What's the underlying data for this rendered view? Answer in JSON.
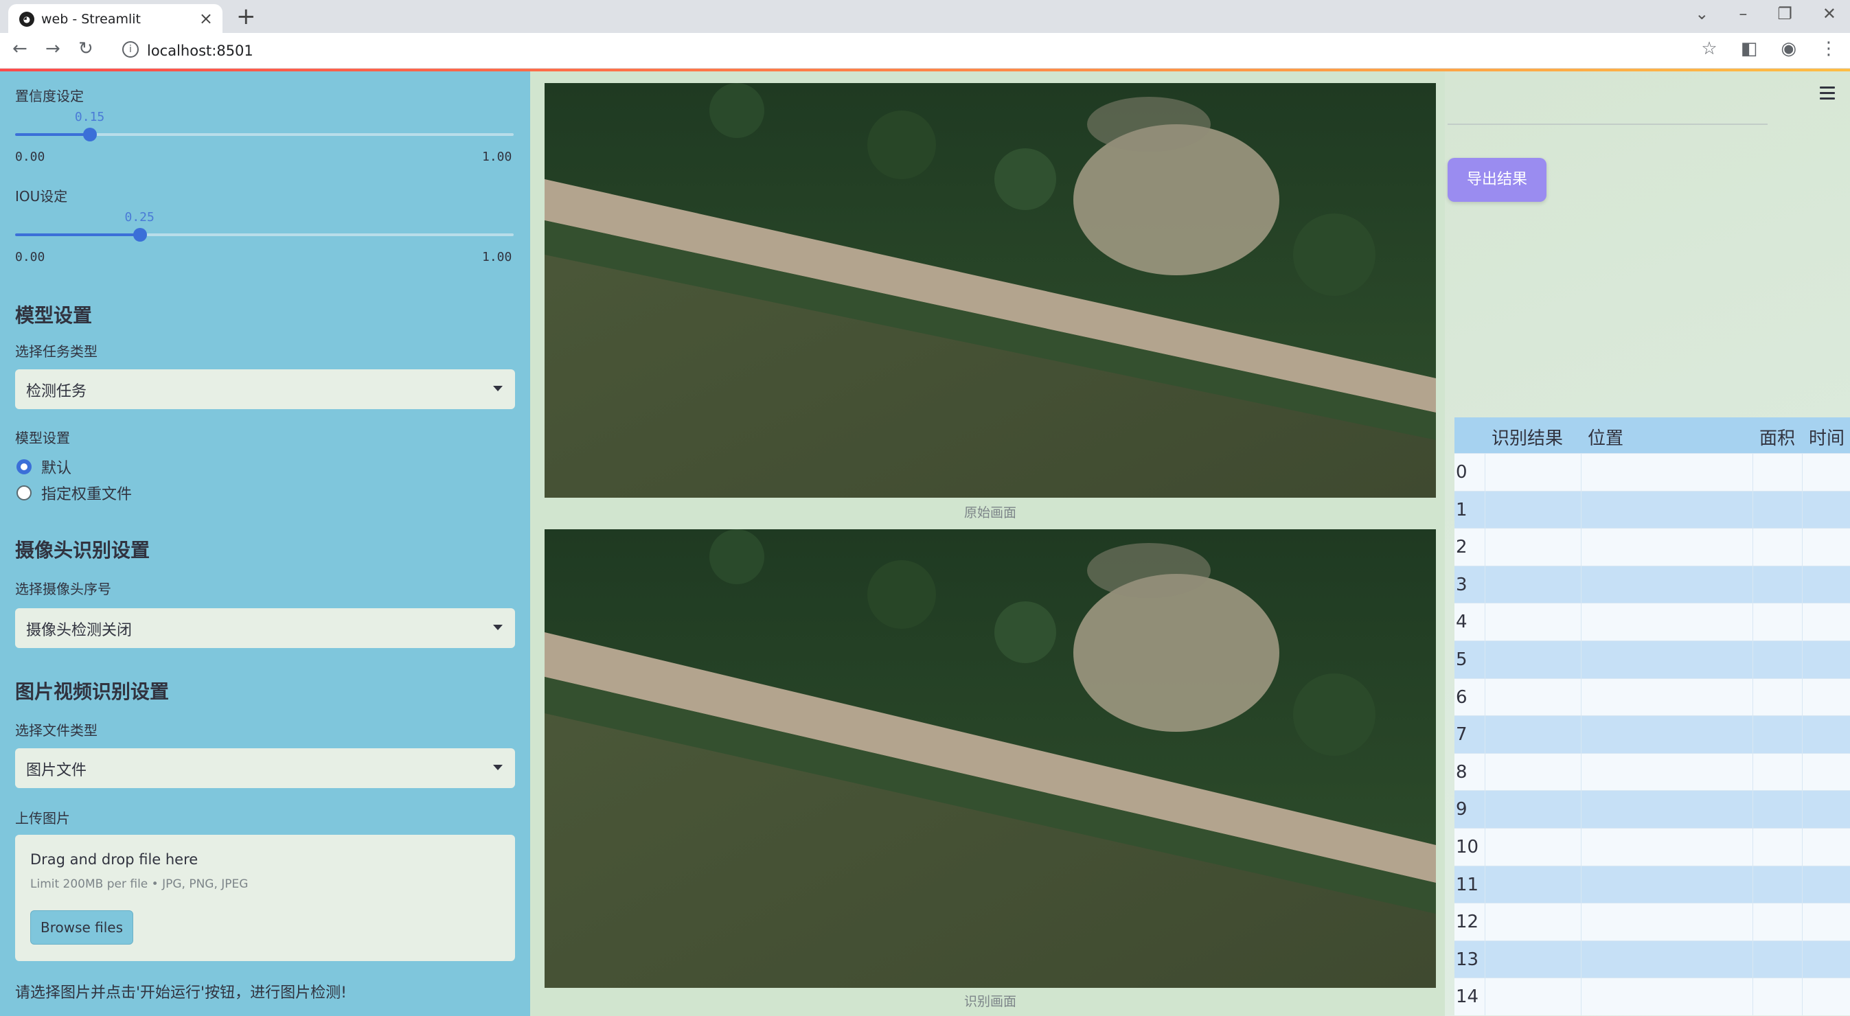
{
  "browser": {
    "tab_title": "web - Streamlit",
    "url": "localhost:8501"
  },
  "sidebar": {
    "confidence": {
      "label": "置信度设定",
      "value": "0.15",
      "min": "0.00",
      "max": "1.00",
      "fraction": 0.15
    },
    "iou": {
      "label": "IOU设定",
      "value": "0.25",
      "min": "0.00",
      "max": "1.00",
      "fraction": 0.25
    },
    "model_section": {
      "heading": "模型设置",
      "task_label": "选择任务类型",
      "task_value": "检测任务",
      "model_label": "模型设置",
      "options": [
        "默认",
        "指定权重文件"
      ],
      "selected": "默认"
    },
    "camera_section": {
      "heading": "摄像头识别设置",
      "camera_label": "选择摄像头序号",
      "camera_value": "摄像头检测关闭"
    },
    "media_section": {
      "heading": "图片视频识别设置",
      "filetype_label": "选择文件类型",
      "filetype_value": "图片文件",
      "upload_label": "上传图片",
      "drop_text": "Drag and drop file here",
      "limit_text": "Limit 200MB per file • JPG, PNG, JPEG",
      "browse_label": "Browse files"
    },
    "hint": "请选择图片并点击'开始运行'按钮，进行图片检测!"
  },
  "main": {
    "original_caption": "原始画面",
    "result_caption": "识别画面",
    "export_label": "导出结果"
  },
  "table": {
    "headers": [
      "识别结果",
      "位置",
      "面积",
      "时间"
    ],
    "row_indices": [
      "0",
      "1",
      "2",
      "3",
      "4",
      "5",
      "6",
      "7",
      "8",
      "9",
      "10",
      "11",
      "12",
      "13",
      "14"
    ]
  }
}
